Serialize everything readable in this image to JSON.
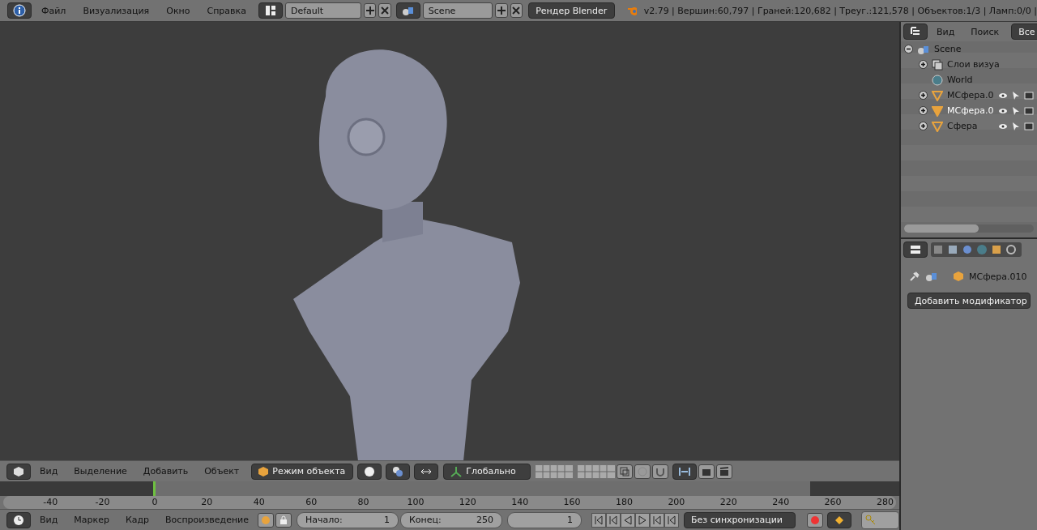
{
  "top_bar": {
    "menus": [
      "Файл",
      "Визуализация",
      "Окно",
      "Справка"
    ],
    "layout": "Default",
    "scene": "Scene",
    "engine": "Рендер Blender",
    "stats": "v2.79 | Вершин:60,797 | Граней:120,682 | Треуг.:121,578 | Объектов:1/3 | Ламп:0/0 |"
  },
  "viewport": {
    "header": {
      "menus": [
        "Вид",
        "Выделение",
        "Добавить",
        "Объект"
      ],
      "mode": "Режим объекта",
      "orientation": "Глобально"
    }
  },
  "outliner": {
    "menus": [
      "Вид",
      "Поиск"
    ],
    "filter": "Все",
    "tree": [
      {
        "label": "Scene",
        "kind": "scene",
        "expanded": true,
        "selected": false,
        "children": [
          {
            "label": "Слои визуа",
            "kind": "layers",
            "expanded": false,
            "selected": false
          },
          {
            "label": "World",
            "kind": "world",
            "selected": false
          },
          {
            "label": "МСфера.0",
            "kind": "mesh",
            "expanded": false,
            "selected": false
          },
          {
            "label": "МСфера.0",
            "kind": "mesh",
            "expanded": false,
            "selected": true
          },
          {
            "label": "Сфера",
            "kind": "mesh",
            "expanded": false,
            "selected": false
          }
        ]
      }
    ]
  },
  "properties": {
    "object": "МСфера.010",
    "add_modifier": "Добавить модификатор"
  },
  "timeline": {
    "ticks": [
      "-40",
      "-20",
      "0",
      "20",
      "40",
      "60",
      "80",
      "100",
      "120",
      "140",
      "160",
      "180",
      "200",
      "220",
      "240",
      "260",
      "280"
    ],
    "header": {
      "menus": [
        "Вид",
        "Маркер",
        "Кадр",
        "Воспроизведение"
      ],
      "start_label": "Начало:",
      "start": "1",
      "end_label": "Конец:",
      "end": "250",
      "current": "1",
      "sync": "Без синхронизации"
    }
  }
}
